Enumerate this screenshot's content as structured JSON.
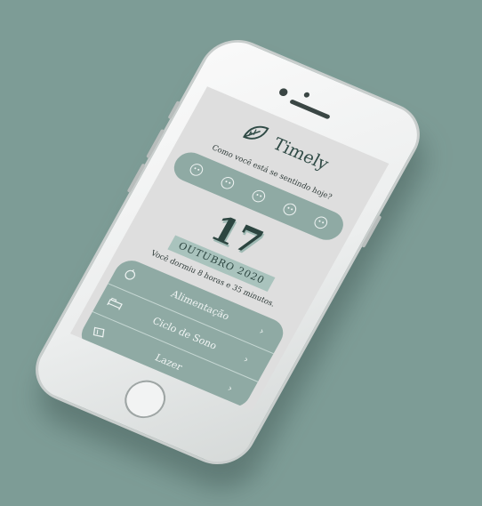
{
  "app": {
    "brand": "Timely",
    "question": "Como você está se sentindo hoje?",
    "moods": [
      "very-sad-face-icon",
      "sad-face-icon",
      "neutral-face-icon",
      "happy-face-icon",
      "very-happy-face-icon"
    ],
    "date": {
      "day": "17",
      "month_year": "OUTUBRO 2020"
    },
    "sleep_text": "Você dormiu 8 horas e 35 minutos.",
    "menu": [
      {
        "label": "Alimentação",
        "icon": "apple-icon"
      },
      {
        "label": "Ciclo de Sono",
        "icon": "bed-icon"
      },
      {
        "label": "Lazer",
        "icon": "ticket-icon"
      }
    ],
    "chevron": "›"
  },
  "colors": {
    "background": "#7d9c96",
    "accent": "#8faaa4",
    "dark": "#2c4540",
    "highlight": "#a9c3bd"
  }
}
